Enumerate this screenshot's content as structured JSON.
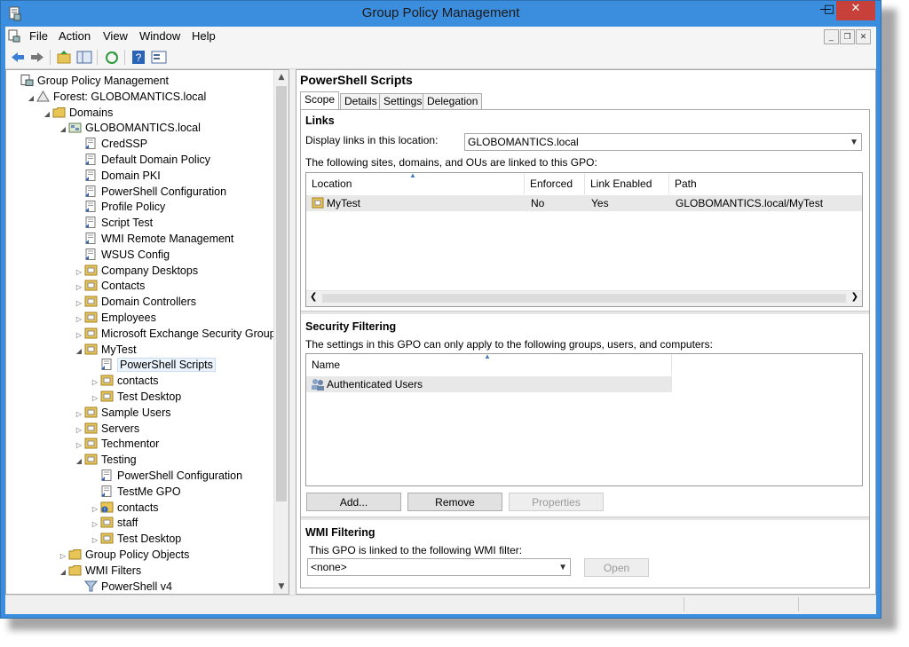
{
  "window": {
    "title": "Group Policy Management",
    "min_glyph": "—",
    "max_glyph": "□",
    "close_glyph": "✕"
  },
  "menu": [
    "File",
    "Action",
    "View",
    "Window",
    "Help"
  ],
  "mdi_controls": [
    "_",
    "❐",
    "✕"
  ],
  "tree": [
    {
      "label": "Group Policy Management",
      "icon": "console-icon",
      "expander": ""
    },
    {
      "label": "Forest: GLOBOMANTICS.local",
      "icon": "forest-icon",
      "expander": "◢"
    },
    {
      "label": "Domains",
      "icon": "folder-icon",
      "expander": "◢"
    },
    {
      "label": "GLOBOMANTICS.local",
      "icon": "domain-icon",
      "expander": "◢"
    },
    {
      "label": "CredSSP",
      "icon": "gpo-link-icon",
      "expander": ""
    },
    {
      "label": "Default Domain Policy",
      "icon": "gpo-link-icon",
      "expander": ""
    },
    {
      "label": "Domain PKI",
      "icon": "gpo-link-icon",
      "expander": ""
    },
    {
      "label": "PowerShell Configuration",
      "icon": "gpo-link-icon",
      "expander": ""
    },
    {
      "label": "Profile Policy",
      "icon": "gpo-link-icon",
      "expander": ""
    },
    {
      "label": "Script Test",
      "icon": "gpo-link-icon",
      "expander": ""
    },
    {
      "label": "WMI Remote Management",
      "icon": "gpo-link-icon",
      "expander": ""
    },
    {
      "label": "WSUS Config",
      "icon": "gpo-link-icon",
      "expander": ""
    },
    {
      "label": "Company Desktops",
      "icon": "ou-icon",
      "expander": "▷"
    },
    {
      "label": "Contacts",
      "icon": "ou-icon",
      "expander": "▷"
    },
    {
      "label": "Domain Controllers",
      "icon": "ou-icon",
      "expander": "▷"
    },
    {
      "label": "Employees",
      "icon": "ou-icon",
      "expander": "▷"
    },
    {
      "label": "Microsoft Exchange Security Groups",
      "icon": "ou-icon",
      "expander": "▷"
    },
    {
      "label": "MyTest",
      "icon": "ou-icon",
      "expander": "◢"
    },
    {
      "label": "PowerShell Scripts",
      "icon": "gpo-link-icon",
      "expander": ""
    },
    {
      "label": "contacts",
      "icon": "ou-icon",
      "expander": "▷"
    },
    {
      "label": "Test Desktop",
      "icon": "ou-icon",
      "expander": "▷"
    },
    {
      "label": "Sample Users",
      "icon": "ou-icon",
      "expander": "▷"
    },
    {
      "label": "Servers",
      "icon": "ou-icon",
      "expander": "▷"
    },
    {
      "label": "Techmentor",
      "icon": "ou-icon",
      "expander": "▷"
    },
    {
      "label": "Testing",
      "icon": "ou-icon",
      "expander": "◢"
    },
    {
      "label": "PowerShell Configuration",
      "icon": "gpo-link-icon",
      "expander": ""
    },
    {
      "label": "TestMe GPO",
      "icon": "gpo-link-icon",
      "expander": ""
    },
    {
      "label": "contacts",
      "icon": "ou-blocked-icon",
      "expander": "▷"
    },
    {
      "label": "staff",
      "icon": "ou-icon",
      "expander": "▷"
    },
    {
      "label": "Test Desktop",
      "icon": "ou-icon",
      "expander": "▷"
    },
    {
      "label": "Group Policy Objects",
      "icon": "folder-icon",
      "expander": "▷"
    },
    {
      "label": "WMI Filters",
      "icon": "folder-icon",
      "expander": "◢"
    },
    {
      "label": "PowerShell v4",
      "icon": "wmi-filter-icon",
      "expander": ""
    }
  ],
  "detail": {
    "title": "PowerShell Scripts",
    "tabs": [
      "Scope",
      "Details",
      "Settings",
      "Delegation"
    ],
    "active_tab": "Scope",
    "links": {
      "heading": "Links",
      "location_label": "Display links in this location:",
      "location_value": "GLOBOMANTICS.local",
      "linked_text": "The following sites, domains, and OUs are linked to this GPO:",
      "columns": [
        "Location",
        "Enforced",
        "Link Enabled",
        "Path"
      ],
      "rows": [
        {
          "location": "MyTest",
          "enforced": "No",
          "link_enabled": "Yes",
          "path": "GLOBOMANTICS.local/MyTest"
        }
      ]
    },
    "security": {
      "heading": "Security Filtering",
      "description": "The settings in this GPO can only apply to the following groups, users, and computers:",
      "columns": [
        "Name"
      ],
      "rows": [
        "Authenticated Users"
      ],
      "buttons": {
        "add": "Add...",
        "remove": "Remove",
        "properties": "Properties"
      }
    },
    "wmi": {
      "heading": "WMI Filtering",
      "description": "This GPO is linked to the following WMI filter:",
      "value": "<none>",
      "open": "Open"
    }
  },
  "colors": {
    "titlebar": "#3b8ede",
    "close": "#c7403a"
  }
}
